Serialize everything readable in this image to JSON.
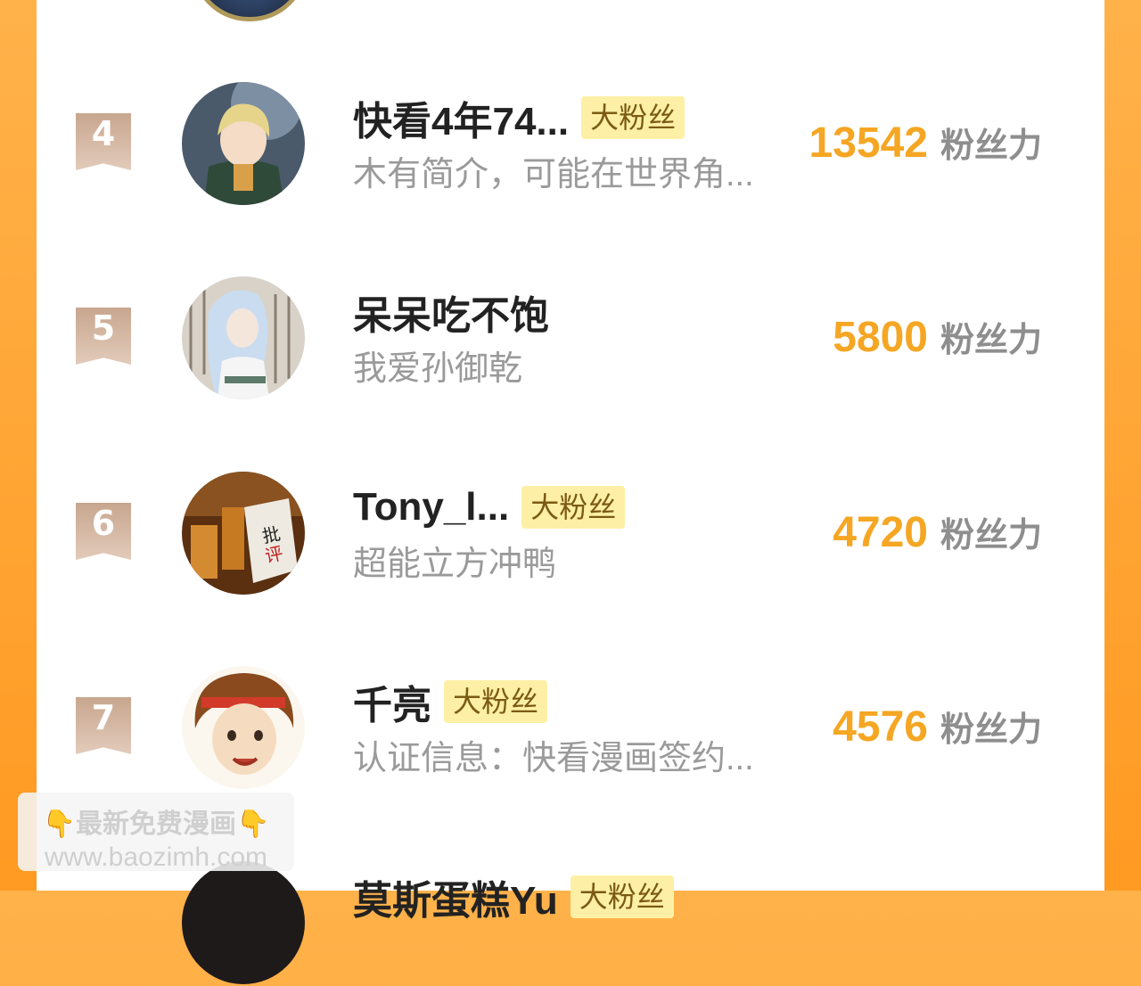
{
  "list": [
    {
      "rank": "4",
      "name": "快看4年74...",
      "badge": "大粉丝",
      "desc": "木有简介，可能在世界角...",
      "score": "13542",
      "unit": "粉丝力"
    },
    {
      "rank": "5",
      "name": "呆呆吃不饱",
      "badge": "",
      "desc": "我爱孙御乾",
      "score": "5800",
      "unit": "粉丝力"
    },
    {
      "rank": "6",
      "name": "Tony_l...",
      "badge": "大粉丝",
      "desc": "超能立方冲鸭",
      "score": "4720",
      "unit": "粉丝力"
    },
    {
      "rank": "7",
      "name": "千亮",
      "badge": "大粉丝",
      "desc": "认证信息：快看漫画签约...",
      "score": "4576",
      "unit": "粉丝力"
    },
    {
      "rank": "",
      "name": "莫斯蛋糕Yu",
      "badge": "大粉丝",
      "desc": "",
      "score": "",
      "unit": ""
    }
  ],
  "watermark": {
    "line1": "最新免费漫画",
    "hand": "👇",
    "line2": "www.baozimh.com"
  },
  "colors": {
    "accent": "#f5a623",
    "badge_bg": "#fdf0a6",
    "rank_tag": "#c8a68e"
  }
}
